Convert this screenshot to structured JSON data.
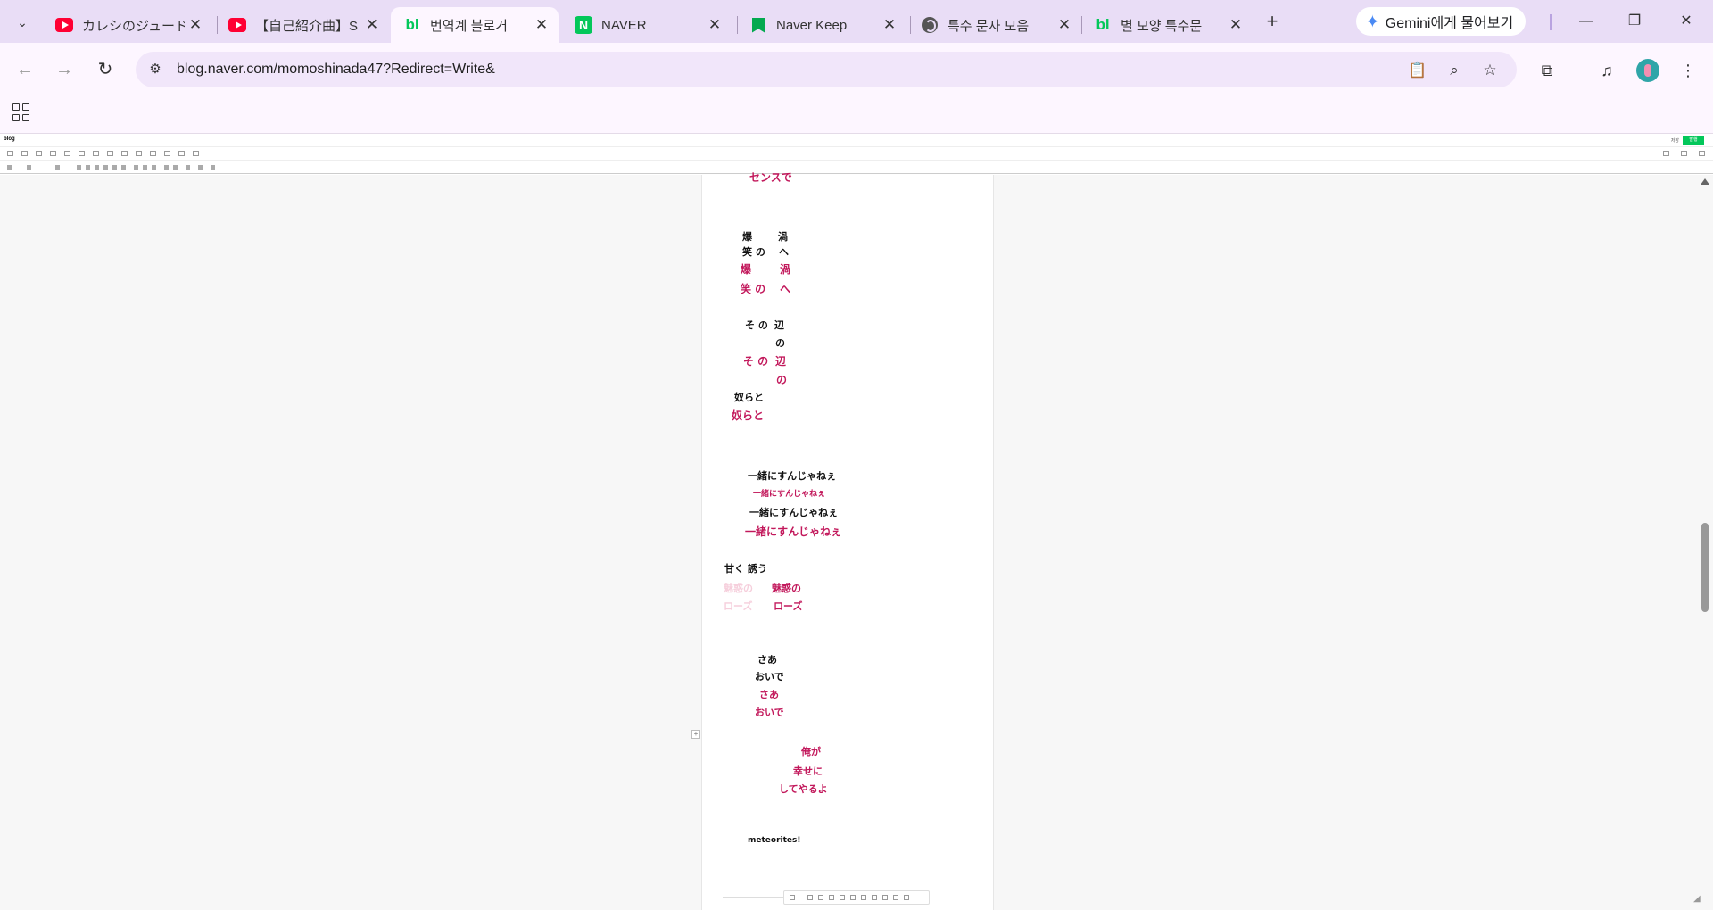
{
  "tabs": [
    {
      "title": "カレシのジュード",
      "icon": "youtube-icon"
    },
    {
      "title": "【自己紹介曲】SI",
      "icon": "youtube-icon"
    },
    {
      "title": "번역계 블로거",
      "icon": "blog-icon",
      "active": true
    },
    {
      "title": "NAVER",
      "icon": "naver-icon"
    },
    {
      "title": "Naver Keep",
      "icon": "keep-icon"
    },
    {
      "title": "특수 문자 모음",
      "icon": "globe-icon"
    },
    {
      "title": "별 모양 특수문",
      "icon": "blog-icon"
    }
  ],
  "tab_close_glyph": "✕",
  "new_tab_glyph": "+",
  "gemini": {
    "label": "Gemini에게 물어보기"
  },
  "address": {
    "url": "blog.naver.com/momoshinada47?Redirect=Write&"
  },
  "editor": {
    "logo": "blog",
    "save_label": "발행",
    "saved_label": "저장"
  },
  "lyrics": {
    "top_cut": "センスで",
    "bakushou_b1": "爆",
    "bakushou_b2": "笑 の",
    "uzu_b1": "渦",
    "uzu_b2": "へ",
    "bakushou_p1": "爆",
    "bakushou_p2": "笑 の",
    "uzu_p1": "渦",
    "uzu_p2": "へ",
    "sono_b": "そ の",
    "hen_b1": "辺",
    "hen_b2": "の",
    "sono_p": "そ の",
    "hen_p1": "辺",
    "hen_p2": "の",
    "yatsura_b": "奴らと",
    "yatsura_p": "奴らと",
    "issho_b1": "一緒にすんじゃねぇ",
    "issho_p1": "一緒にすんじゃねぇ",
    "issho_b2": "一緒にすんじゃねぇ",
    "issho_p2": "一緒にすんじゃねぇ",
    "amaku": "甘く 誘う",
    "faint1": "魅惑の",
    "faint2": "ローズ",
    "miwaku": "魅惑の",
    "rose": "ローズ",
    "saa_b": "さあ",
    "oide_b": "おいで",
    "saa_p": "さあ",
    "oide_p": "おいで",
    "ore": "俺が",
    "shiawase": "幸せに",
    "shiteyaru": "してやるよ",
    "meteorites": "meteorites!"
  }
}
